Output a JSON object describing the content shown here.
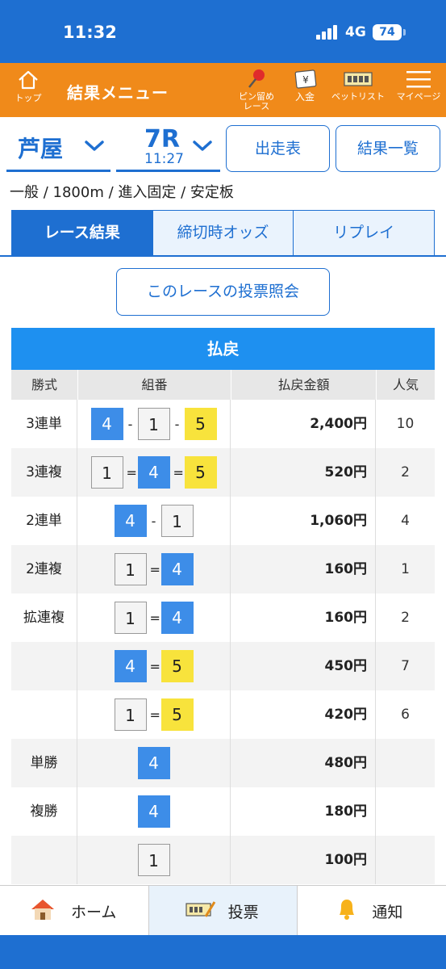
{
  "status": {
    "time": "11:32",
    "network": "4G",
    "battery": "74"
  },
  "topnav": {
    "home_label": "トップ",
    "title": "結果メニュー",
    "pin_label_1": "ピン留め",
    "pin_label_2": "レース",
    "deposit_label": "入金",
    "betlist_label": "ベットリスト",
    "mypage_label": "マイページ"
  },
  "header": {
    "venue": "芦屋",
    "race_no": "7R",
    "race_time": "11:27",
    "entries_button": "出走表",
    "results_button": "結果一覧"
  },
  "condition": "一般 / 1800m / 進入固定 / 安定板",
  "tabs": [
    "レース結果",
    "締切時オッズ",
    "リプレイ"
  ],
  "vote_check_button": "このレースの投票照会",
  "payout": {
    "title": "払戻",
    "headers": [
      "勝式",
      "組番",
      "払戻金額",
      "人気"
    ],
    "rows": [
      {
        "type": "3連単",
        "combo": [
          "4",
          "-",
          "1",
          "-",
          "5"
        ],
        "amount": "2,400円",
        "pop": "10"
      },
      {
        "type": "3連複",
        "combo": [
          "1",
          "=",
          "4",
          "=",
          "5"
        ],
        "amount": "520円",
        "pop": "2"
      },
      {
        "type": "2連単",
        "combo": [
          "4",
          "-",
          "1"
        ],
        "amount": "1,060円",
        "pop": "4"
      },
      {
        "type": "2連複",
        "combo": [
          "1",
          "=",
          "4"
        ],
        "amount": "160円",
        "pop": "1"
      },
      {
        "type": "拡連複",
        "combo": [
          "1",
          "=",
          "4"
        ],
        "amount": "160円",
        "pop": "2"
      },
      {
        "type": "",
        "combo": [
          "4",
          "=",
          "5"
        ],
        "amount": "450円",
        "pop": "7"
      },
      {
        "type": "",
        "combo": [
          "1",
          "=",
          "5"
        ],
        "amount": "420円",
        "pop": "6"
      },
      {
        "type": "単勝",
        "combo": [
          "4"
        ],
        "amount": "480円",
        "pop": ""
      },
      {
        "type": "複勝",
        "combo": [
          "4"
        ],
        "amount": "180円",
        "pop": ""
      },
      {
        "type": "",
        "combo": [
          "1"
        ],
        "amount": "100円",
        "pop": ""
      }
    ]
  },
  "bottomnav": {
    "home": "ホーム",
    "vote": "投票",
    "notify": "通知"
  },
  "colors": {
    "brand_blue": "#1e6fd1",
    "orange": "#f08a1a",
    "boat1": "#f4f4f4",
    "boat4": "#3d8de8",
    "boat5": "#f8e33c"
  }
}
